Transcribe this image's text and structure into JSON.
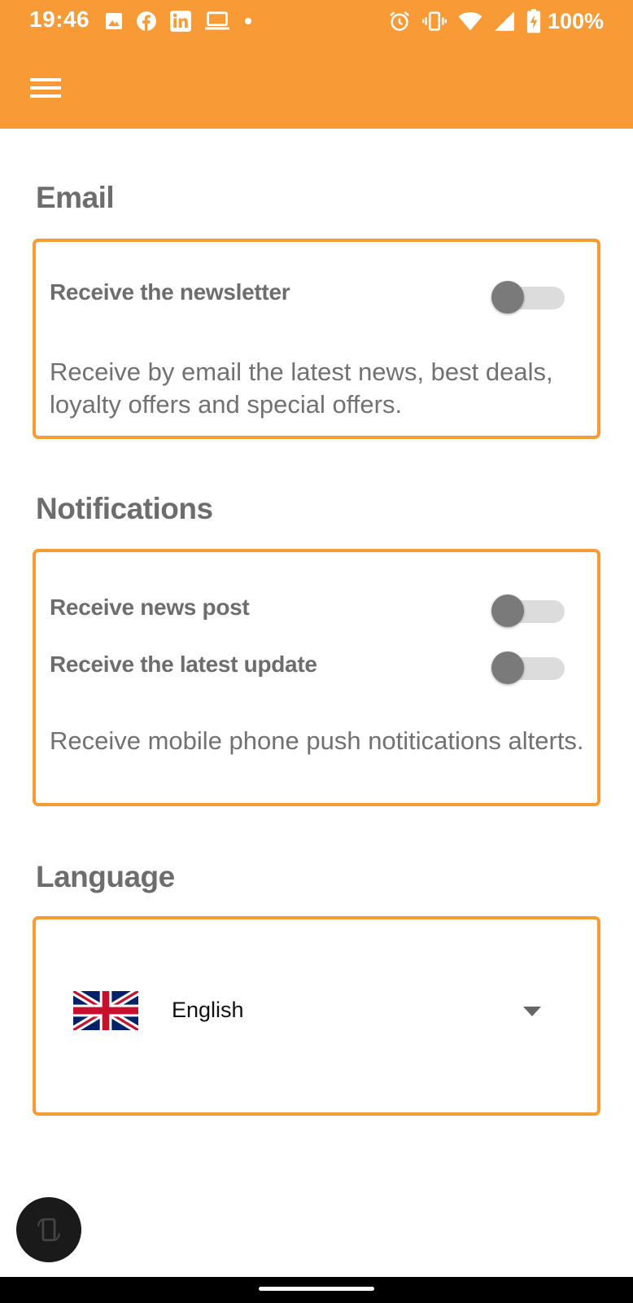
{
  "status_bar": {
    "time": "19:46",
    "battery": "100%",
    "left_icons": [
      "image-icon",
      "facebook-icon",
      "linkedin-icon",
      "laptop-icon",
      "dot-icon"
    ],
    "right_icons": [
      "alarm-icon",
      "vibrate-icon",
      "wifi-icon",
      "signal-icon",
      "battery-charging-icon"
    ]
  },
  "colors": {
    "accent": "#F89A36",
    "heading": "#6d6d6d",
    "body_text": "#717171",
    "switch_thumb_off": "#7a7a7a",
    "switch_track_off": "#dcdcdc"
  },
  "app_bar": {
    "menu_icon": "hamburger-menu-icon"
  },
  "email": {
    "title": "Email",
    "newsletter_label": "Receive the newsletter",
    "newsletter_on": false,
    "description": "Receive by email the latest news, best deals, loyalty offers and special offers."
  },
  "notifications": {
    "title": "Notifications",
    "news_post_label": "Receive news post",
    "news_post_on": false,
    "latest_update_label": "Receive the latest update",
    "latest_update_on": false,
    "description": "Receive mobile phone push notitications alterts."
  },
  "language": {
    "title": "Language",
    "selected": "English",
    "flag_icon": "uk-flag-icon"
  },
  "fab": {
    "icon": "screen-rotate-icon"
  }
}
